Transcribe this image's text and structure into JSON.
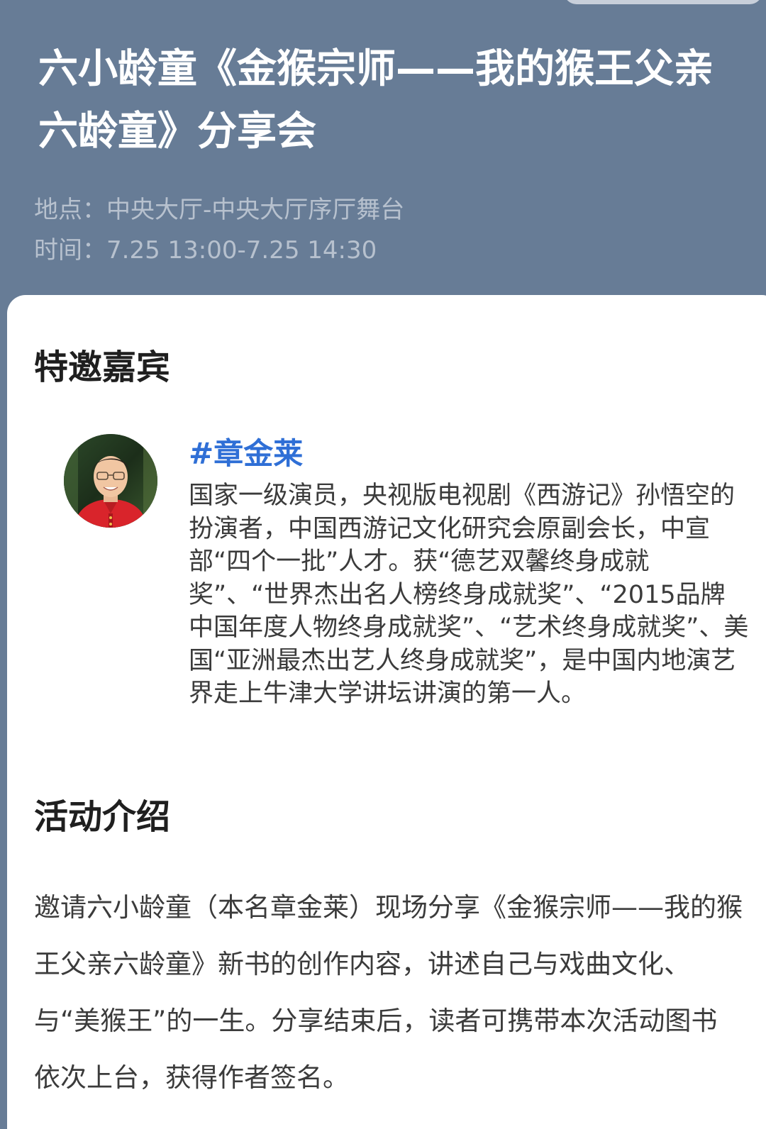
{
  "header": {
    "title": "六小龄童《金猴宗师——我的猴王父亲六龄童》分享会",
    "location": "地点：中央大厅-中央大厅序厅舞台",
    "time": "时间：7.25 13:00-7.25 14:30"
  },
  "guests_section": {
    "title": "特邀嘉宾",
    "guests": [
      {
        "name": "#章金莱",
        "bio": "国家一级演员，央视版电视剧《西游记》孙悟空的扮演者，中国西游记文化研究会原副会长，中宣部“四个一批”人才。获“德艺双馨终身成就奖”、“世界杰出名人榜终身成就奖”、“2015品牌中国年度人物终身成就奖”、“艺术终身成就奖”、美国“亚洲最杰出艺人终身成就奖”，是中国内地演艺界走上牛津大学讲坛讲演的第一人。"
      }
    ]
  },
  "intro_section": {
    "title": "活动介绍",
    "text": "邀请六小龄童（本名章金莱）现场分享《金猴宗师——我的猴王父亲六龄童》新书的创作内容，讲述自己与戏曲文化、与“美猴王”的一生。分享结束后，读者可携带本次活动图书依次上台，获得作者签名。"
  },
  "colors": {
    "header_bg": "#677c96",
    "title_text": "#ffffff",
    "meta_text": "#b7c1ce",
    "guest_name": "#2f6fd6",
    "body_text": "#3b3b3b",
    "section_heading": "#1f1f1f"
  }
}
